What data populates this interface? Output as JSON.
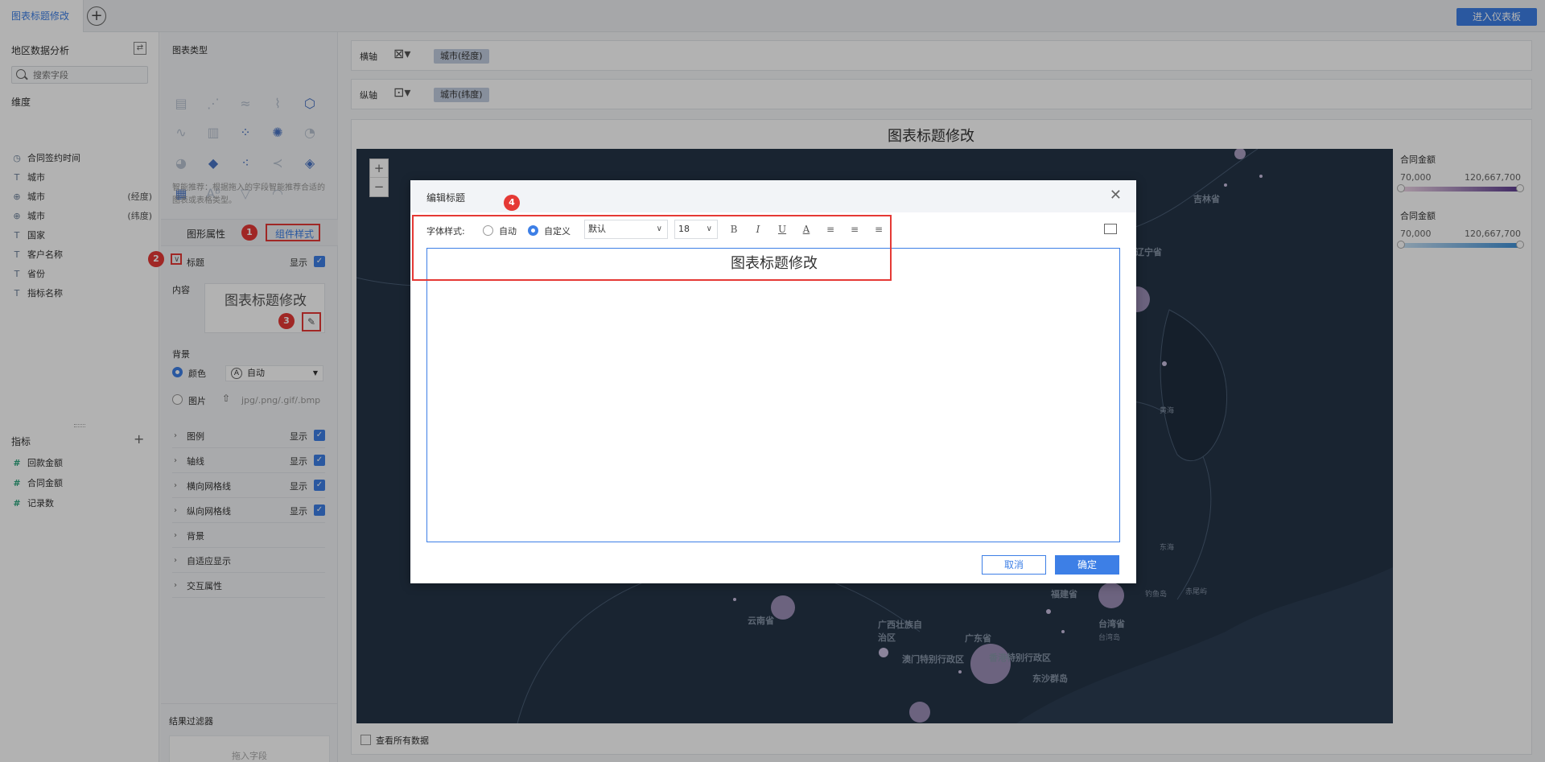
{
  "topbar": {
    "active_tab": "图表标题修改",
    "add_tab": "+",
    "enter_dashboard": "进入仪表板"
  },
  "left": {
    "dataset_title": "地区数据分析",
    "search_placeholder": "搜索字段",
    "dimensions_title": "维度",
    "dimensions": [
      {
        "icon": "clock-icon",
        "glyph": "◷",
        "label": "合同签约时间",
        "extra": ""
      },
      {
        "icon": "text-icon",
        "glyph": "T",
        "label": "城市",
        "extra": ""
      },
      {
        "icon": "globe-icon",
        "glyph": "⊕",
        "label": "城市",
        "extra": "(经度)"
      },
      {
        "icon": "globe-icon",
        "glyph": "⊕",
        "label": "城市",
        "extra": "(纬度)"
      },
      {
        "icon": "text-icon",
        "glyph": "T",
        "label": "国家",
        "extra": ""
      },
      {
        "icon": "text-icon",
        "glyph": "T",
        "label": "客户名称",
        "extra": ""
      },
      {
        "icon": "text-icon",
        "glyph": "T",
        "label": "省份",
        "extra": ""
      },
      {
        "icon": "text-icon",
        "glyph": "T",
        "label": "指标名称",
        "extra": ""
      }
    ],
    "metrics_title": "指标",
    "metrics": [
      {
        "label": "回款金额"
      },
      {
        "label": "合同金额"
      },
      {
        "label": "记录数"
      }
    ]
  },
  "config": {
    "chart_type_title": "图表类型",
    "smart_tip": "智能推荐：根据拖入的字段智能推荐合适的图表或表格类型。",
    "tab_shape": "图形属性",
    "tab_component": "组件样式",
    "title_section": "标题",
    "show": "显示",
    "content_label": "内容",
    "content_value": "图表标题修改",
    "background_label": "背景",
    "bg_color": "颜色",
    "bg_color_value": "自动",
    "bg_image": "图片",
    "bg_image_hint": "jpg/.png/.gif/.bmp",
    "sections": [
      {
        "label": "图例",
        "show": "显示",
        "checked": true
      },
      {
        "label": "轴线",
        "show": "显示",
        "checked": true
      },
      {
        "label": "横向网格线",
        "show": "显示",
        "checked": true
      },
      {
        "label": "纵向网格线",
        "show": "显示",
        "checked": true
      },
      {
        "label": "背景"
      },
      {
        "label": "自适应显示"
      },
      {
        "label": "交互属性"
      }
    ],
    "result_filter": "结果过滤器",
    "drop_field": "拖入字段",
    "badges": [
      "1",
      "2",
      "3",
      "4"
    ]
  },
  "main": {
    "x_axis_label": "横轴",
    "x_axis_field": "城市(经度)",
    "y_axis_label": "纵轴",
    "y_axis_field": "城市(纬度)",
    "chart_title": "图表标题修改",
    "view_all": "查看所有数据",
    "cities": [
      "吉林省",
      "辽宁省",
      "黄海",
      "东海",
      "福建省",
      "台湾省",
      "台湾岛",
      "钓鱼岛",
      "赤尾屿",
      "云南省",
      "广西壮族自治区",
      "广东省",
      "澳门特别行政区",
      "香港特别行政区",
      "东沙群岛"
    ],
    "legend": [
      {
        "title": "合同金额",
        "min": "70,000",
        "max": "120,667,700",
        "color_from": "#f0d8e8",
        "color_to": "#5b3a8e"
      },
      {
        "title": "合同金额",
        "min": "70,000",
        "max": "120,667,700",
        "color_from": "#c9e2f5",
        "color_to": "#3d8fd6"
      }
    ]
  },
  "dialog": {
    "title": "编辑标题",
    "font_style_label": "字体样式:",
    "auto": "自动",
    "custom": "自定义",
    "font_family": "默认",
    "font_size": "18",
    "bold": "B",
    "italic": "I",
    "underline": "U",
    "font_color": "A",
    "editor_text": "图表标题修改",
    "cancel": "取消",
    "confirm": "确定"
  },
  "colors": {
    "accent": "#3d7fe6",
    "annotation": "#e53935",
    "map_bg": "#2c3d52"
  }
}
